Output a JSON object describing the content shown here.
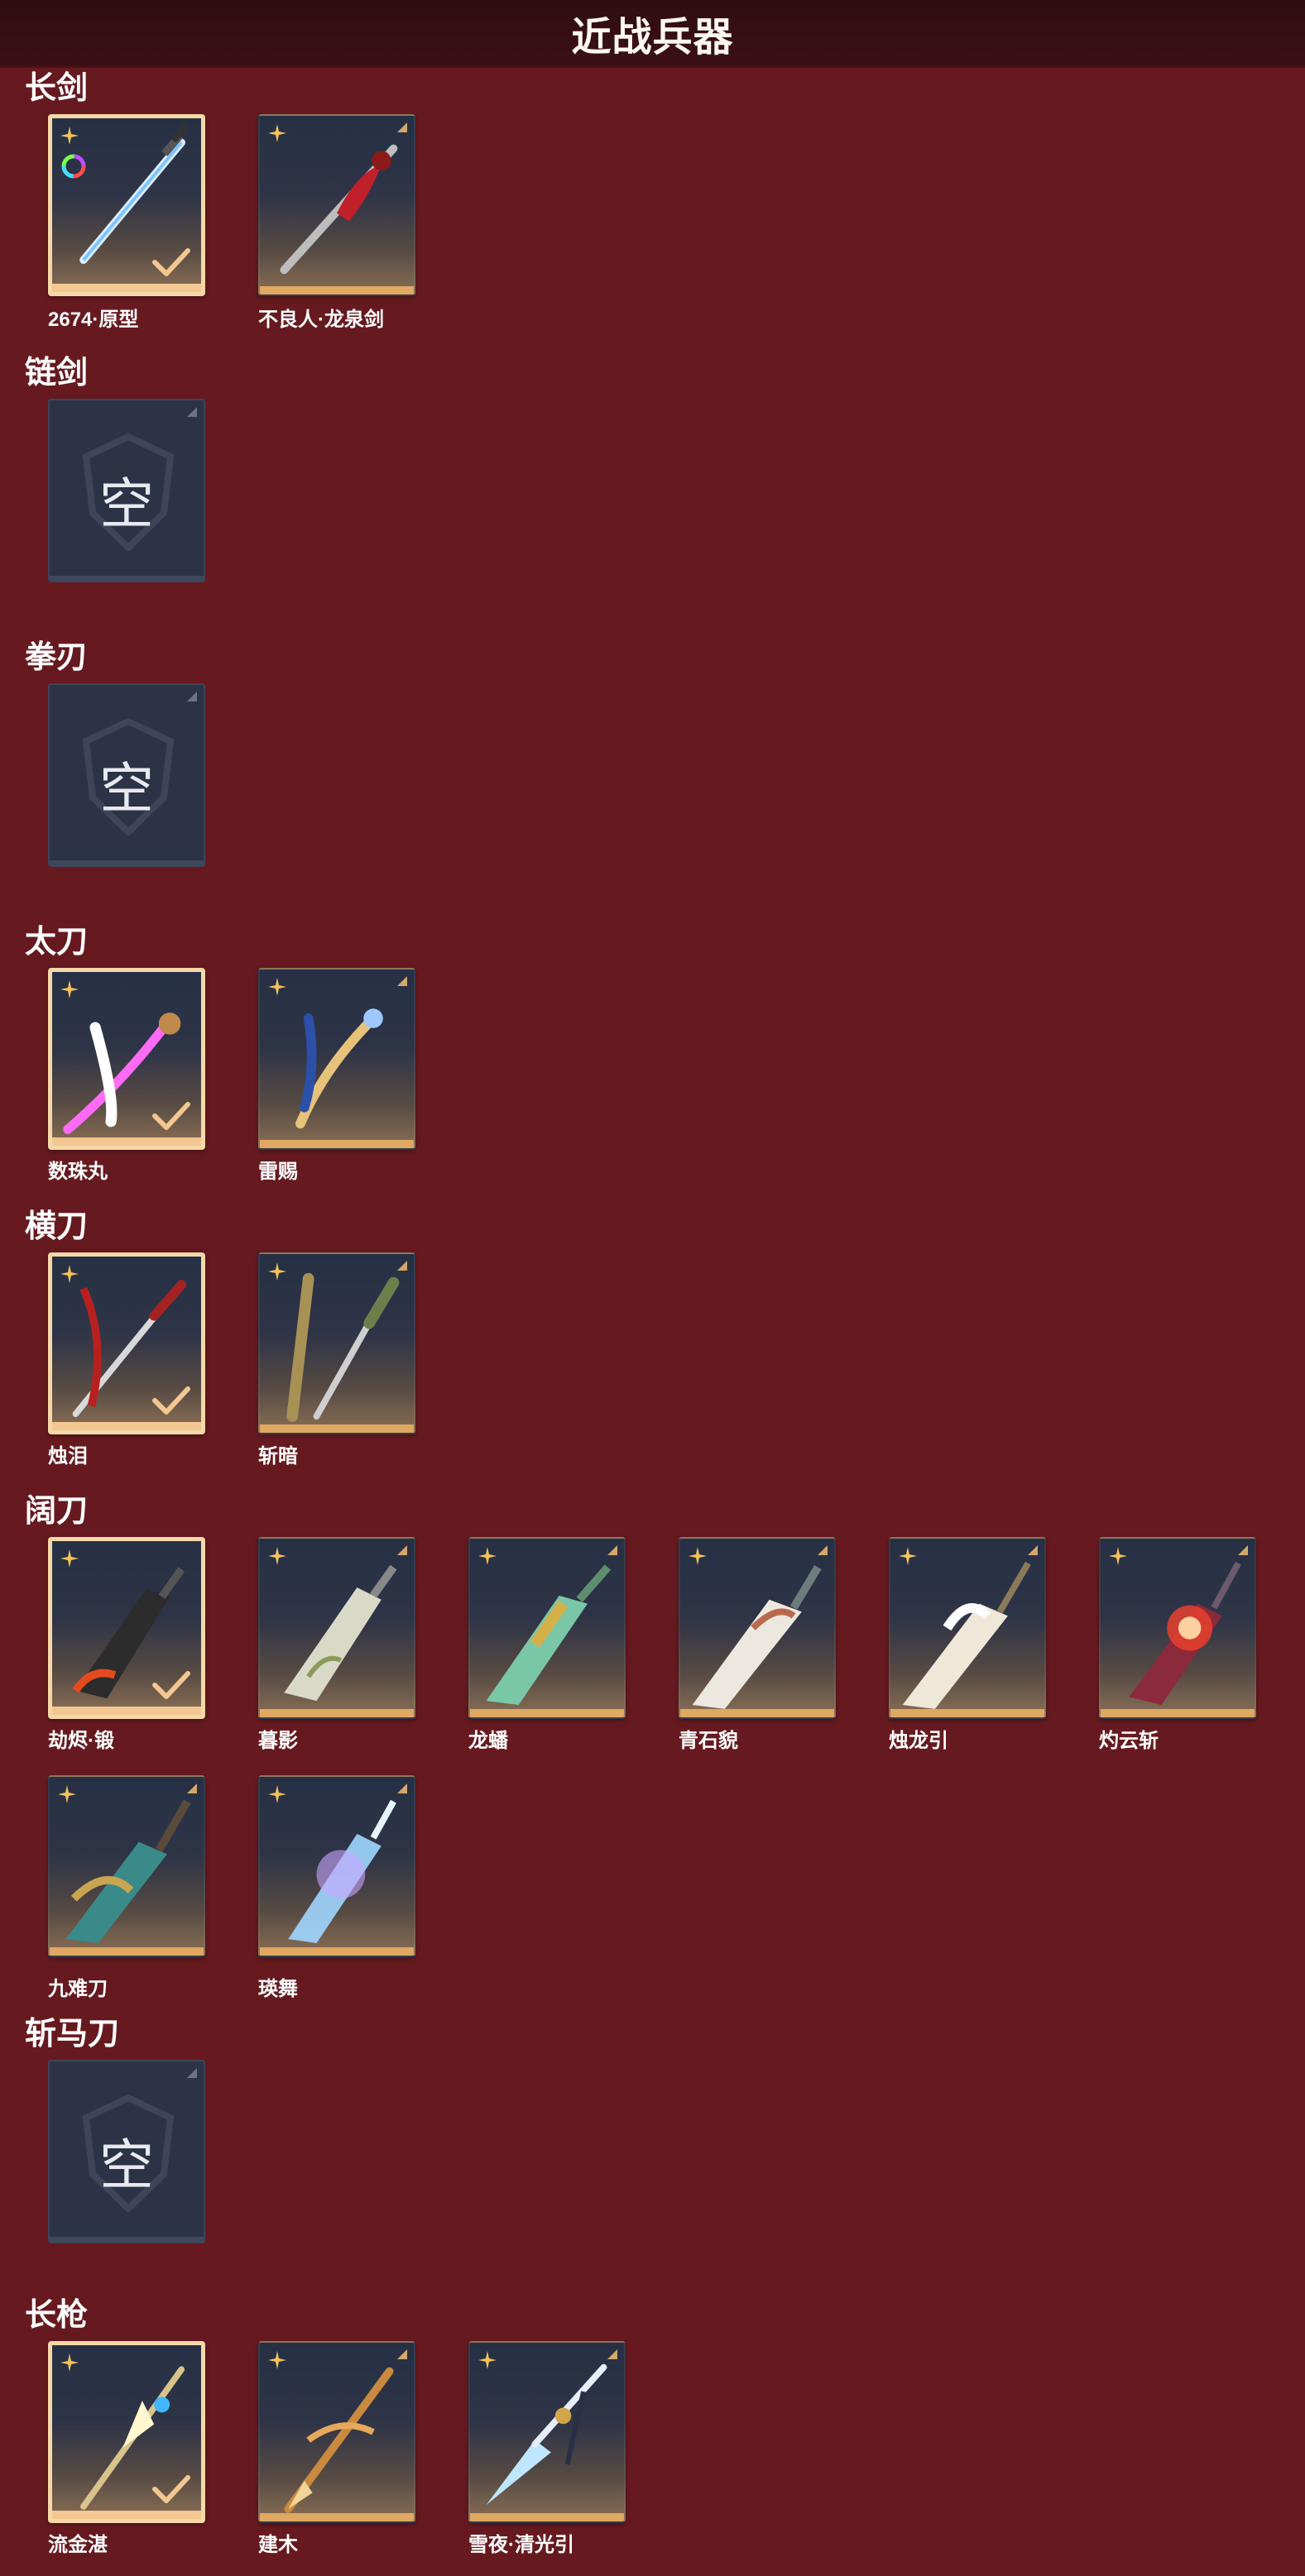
{
  "header": {
    "title": "近战兵器"
  },
  "labels": {
    "empty": "空"
  },
  "colors": {
    "background": "#661a20",
    "header": "#33100f",
    "accent": "#e0a860",
    "selected_border": "#f6d8a8"
  },
  "sections": [
    {
      "title": "长剑",
      "items": [
        {
          "name": "2674·原型",
          "selected": true,
          "rainbow": true,
          "art": "blue-sword"
        },
        {
          "name": "不良人·龙泉剑",
          "selected": false,
          "art": "red-sword"
        }
      ]
    },
    {
      "title": "链剑",
      "items": [
        {
          "empty": true
        }
      ]
    },
    {
      "title": "拳刃",
      "items": [
        {
          "empty": true
        }
      ]
    },
    {
      "title": "太刀",
      "items": [
        {
          "name": "数珠丸",
          "selected": true,
          "art": "purple-blade"
        },
        {
          "name": "雷赐",
          "selected": false,
          "art": "gold-blade"
        }
      ]
    },
    {
      "title": "横刀",
      "items": [
        {
          "name": "烛泪",
          "selected": true,
          "art": "red-katana"
        },
        {
          "name": "斩暗",
          "selected": false,
          "art": "green-katana"
        }
      ]
    },
    {
      "title": "阔刀",
      "items": [
        {
          "name": "劫烬·锻",
          "selected": true,
          "art": "dark-broad"
        },
        {
          "name": "暮影",
          "selected": false,
          "art": "silver-broad"
        },
        {
          "name": "龙蟠",
          "selected": false,
          "art": "jade-broad"
        },
        {
          "name": "青石貌",
          "selected": false,
          "art": "white-broad"
        },
        {
          "name": "烛龙引",
          "selected": false,
          "art": "ivory-broad"
        },
        {
          "name": "灼云斩",
          "selected": false,
          "art": "fire-broad"
        },
        {
          "name": "九难刀",
          "selected": false,
          "art": "teal-broad"
        },
        {
          "name": "瑛舞",
          "selected": false,
          "art": "ice-broad"
        }
      ]
    },
    {
      "title": "斩马刀",
      "items": [
        {
          "empty": true
        }
      ]
    },
    {
      "title": "长枪",
      "items": [
        {
          "name": "流金湛",
          "selected": true,
          "art": "gold-spear"
        },
        {
          "name": "建木",
          "selected": false,
          "art": "wood-spear"
        },
        {
          "name": "雪夜·清光引",
          "selected": false,
          "art": "ice-spear"
        }
      ]
    }
  ]
}
